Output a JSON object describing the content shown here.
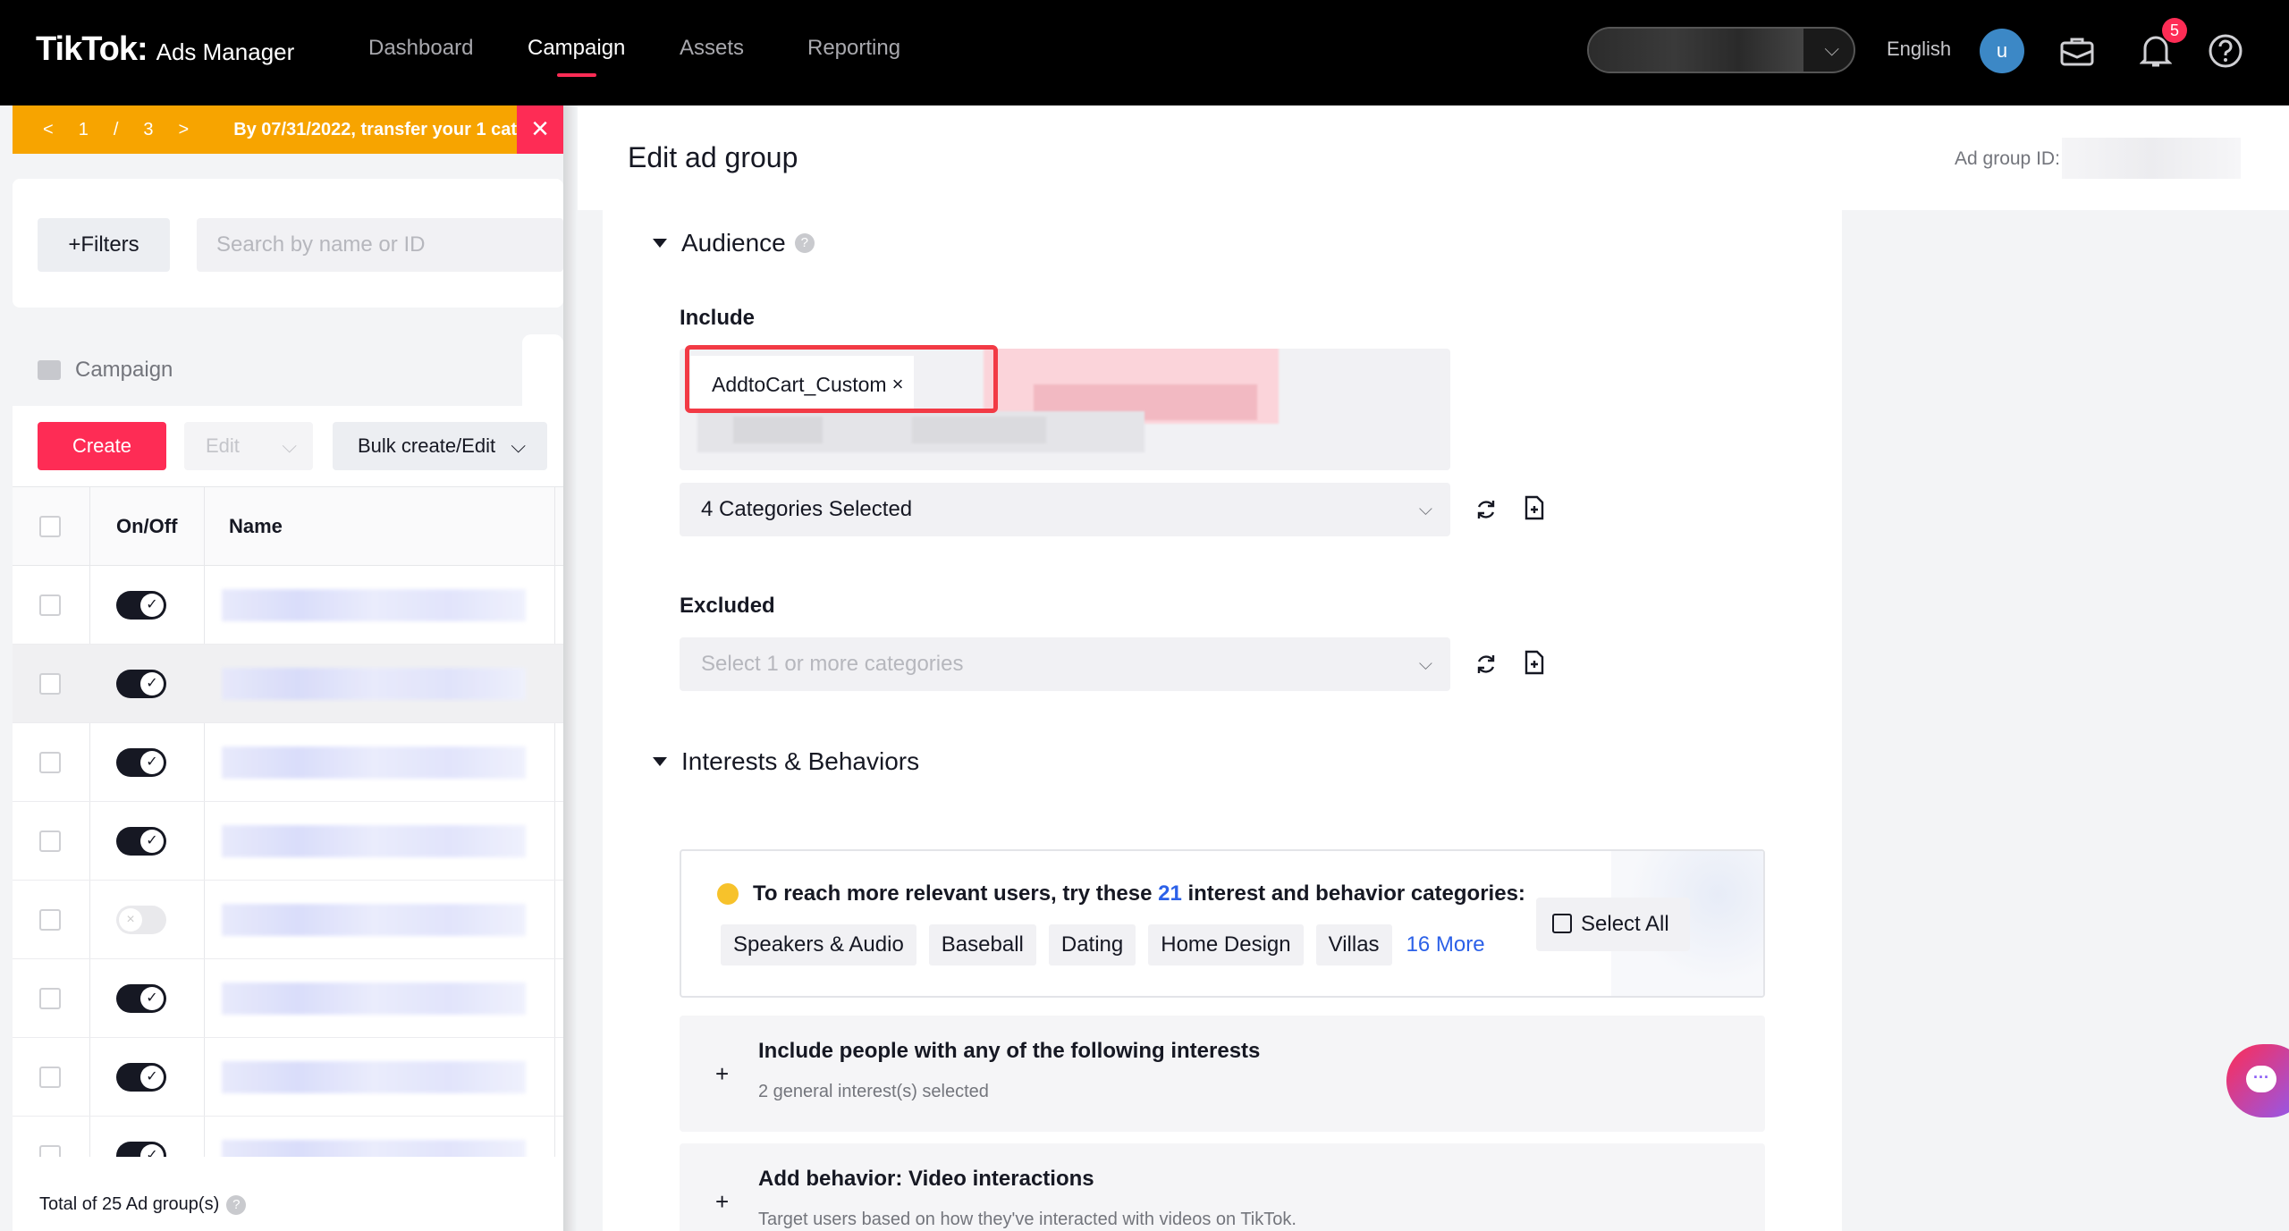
{
  "topnav": {
    "brand": "TikTok",
    "brand_colon": ":",
    "product": "Ads Manager",
    "items": [
      {
        "label": "Dashboard",
        "active": false
      },
      {
        "label": "Campaign",
        "active": true
      },
      {
        "label": "Assets",
        "active": false
      },
      {
        "label": "Reporting",
        "active": false
      }
    ],
    "language": "English",
    "avatar_letter": "u",
    "notification_count": "5",
    "icons": [
      "chevron-down-icon",
      "briefcase-icon",
      "bell-icon",
      "help-icon"
    ]
  },
  "announcement": {
    "current": "1",
    "separator": "/",
    "total": "3",
    "message": "By 07/31/2022, transfer your 1 cat"
  },
  "filters": {
    "button_label": "+Filters",
    "search_placeholder": "Search by name or ID"
  },
  "campaign_tab": {
    "label": "Campaign"
  },
  "toolbar": {
    "create_label": "Create",
    "edit_label": "Edit",
    "bulk_label": "Bulk create/Edit"
  },
  "table": {
    "columns": [
      "On/Off",
      "Name"
    ],
    "rows": [
      {
        "on": true
      },
      {
        "on": true
      },
      {
        "on": true
      },
      {
        "on": true
      },
      {
        "on": false
      },
      {
        "on": true
      },
      {
        "on": true
      },
      {
        "on": true
      }
    ],
    "total_label": "Total of 25 Ad group(s)"
  },
  "drawer": {
    "title": "Edit ad group",
    "ad_group_id_label": "Ad group ID:",
    "audience": {
      "section_title": "Audience",
      "include_label": "Include",
      "include_tag": "AddtoCart_Custom",
      "include_select": "4 Categories Selected",
      "excluded_label": "Excluded",
      "excluded_placeholder": "Select 1 or more categories"
    },
    "interests": {
      "section_title": "Interests & Behaviors",
      "suggestion_prefix": "To reach more relevant users, try these ",
      "suggestion_count": "21",
      "suggestion_suffix": " interest and behavior categories:",
      "chips": [
        "Speakers & Audio",
        "Baseball",
        "Dating",
        "Home Design",
        "Villas"
      ],
      "more_label": "16 More",
      "select_all_label": "Select All",
      "accordions": [
        {
          "title": "Include people with any of the following interests",
          "subtitle": "2 general interest(s) selected"
        },
        {
          "title": "Add behavior: Video interactions",
          "subtitle": "Target users based on how they've interacted with videos on TikTok."
        }
      ]
    }
  },
  "colors": {
    "brand_red": "#fe2c55",
    "highlight_outline": "#f23a45",
    "link_blue": "#2c61e8",
    "announce_orange": "#f7a400"
  }
}
